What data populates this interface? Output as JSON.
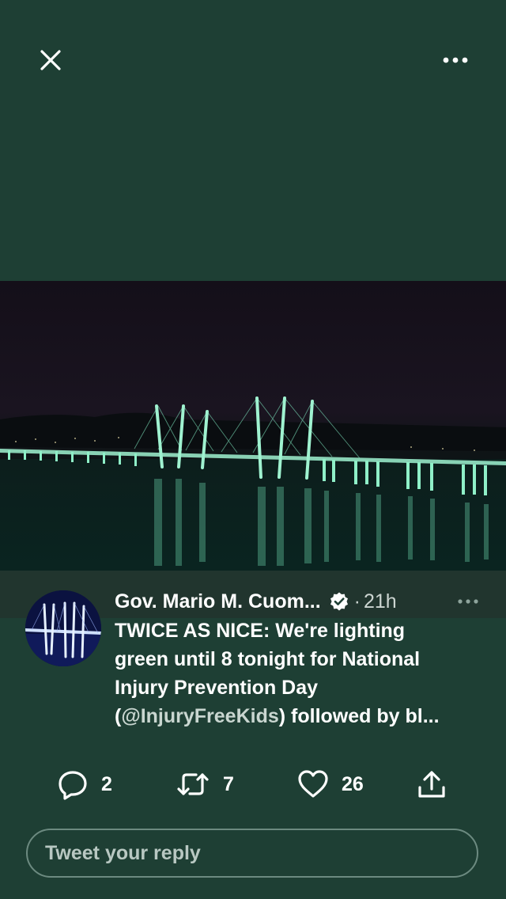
{
  "topbar": {
    "close_icon": "close-icon",
    "more_icon": "more-horizontal-icon"
  },
  "media": {
    "scene": "bridge-at-night",
    "accent_color": "#7fe8c0"
  },
  "tweet": {
    "author": "Gov. Mario M. Cuom...",
    "verified": true,
    "separator": "·",
    "time": "21h",
    "text_line1": "TWICE AS NICE: We're lighting",
    "text_line2": "green until 8 tonight for National",
    "text_line3": "Injury Prevention Day",
    "text_mention_open": "(",
    "text_mention": "@InjuryFreeKids",
    "text_line4_rest": ") followed by bl..."
  },
  "actions": {
    "reply_count": "2",
    "retweet_count": "7",
    "like_count": "26"
  },
  "reply": {
    "placeholder": "Tweet your reply"
  },
  "colors": {
    "background": "#1e3f34",
    "text": "#ffffff",
    "muted": "#ccd5d1"
  }
}
